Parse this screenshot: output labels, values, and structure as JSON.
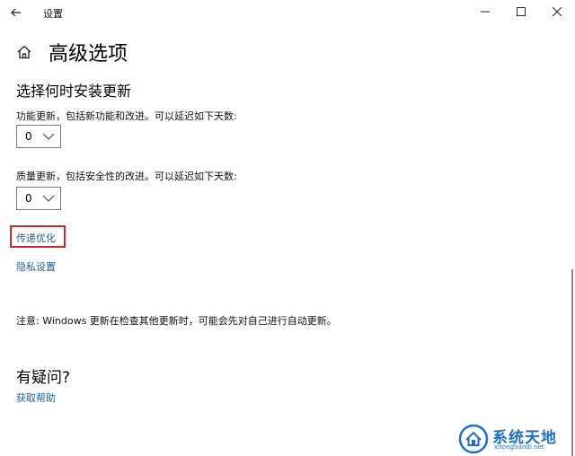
{
  "titlebar": {
    "app_title": "设置",
    "back_icon": "back-arrow-icon",
    "minimize_icon": "minimize-icon",
    "maximize_icon": "maximize-icon",
    "close_icon": "close-icon"
  },
  "page": {
    "title": "高级选项",
    "home_icon": "home-icon"
  },
  "update_timing": {
    "heading": "选择何时安装更新",
    "feature_label": "功能更新，包括新功能和改进。可以延迟如下天数:",
    "feature_value": "0",
    "quality_label": "质量更新，包括安全性的改进。可以延迟如下天数:",
    "quality_value": "0"
  },
  "links": {
    "delivery_optimization": "传递优化",
    "privacy_settings": "隐私设置"
  },
  "note": "注意: Windows 更新在检查其他更新时，可能会先对自己进行自动更新。",
  "questions": {
    "heading": "有疑问?",
    "get_help": "获取帮助"
  },
  "watermark": {
    "text": "系统天地",
    "sub": "xitongtiandi.net",
    "colors": {
      "primary": "#1e6fc9"
    }
  },
  "colors": {
    "link": "#1a63a8",
    "highlight": "#cc2a2a"
  }
}
